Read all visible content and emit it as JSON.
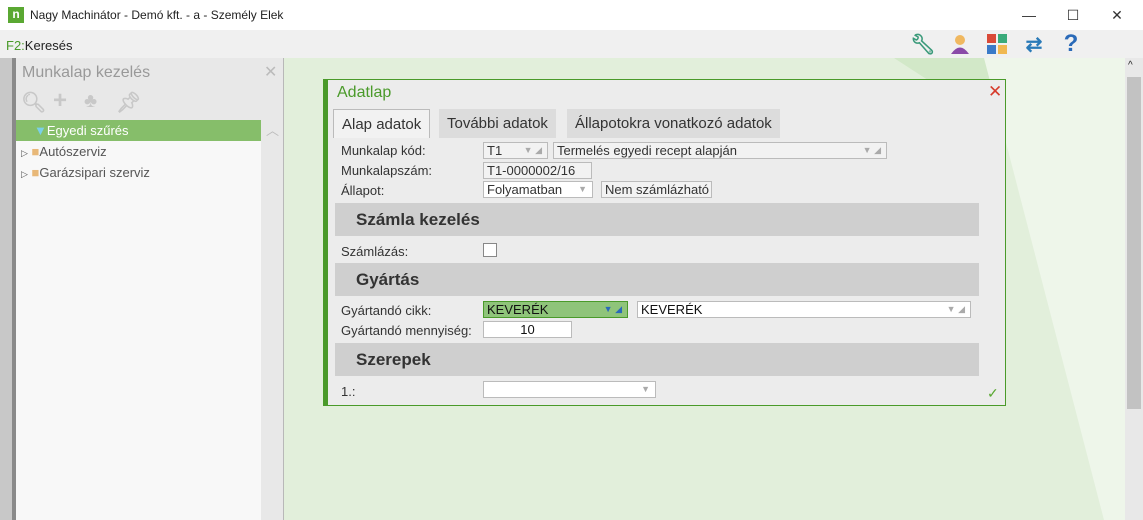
{
  "window": {
    "title": "Nagy Machinátor - Demó kft. - a - Személy Elek",
    "logo": "n",
    "minimize": "—",
    "maximize": "☐",
    "close": "✕"
  },
  "toolbar": {
    "shortcut_key": "F2:",
    "shortcut_label": "Keresés",
    "icons": [
      "wrench-icon",
      "user-icon",
      "tiles-icon",
      "transfer-icon",
      "help-icon"
    ]
  },
  "left_panel": {
    "title": "Munkalap kezelés",
    "tree": [
      {
        "label": "Egyedi szűrés",
        "selected": true
      },
      {
        "label": "Autószerviz"
      },
      {
        "label": "Garázsipari szerviz"
      }
    ]
  },
  "dialog": {
    "title": "Adatlap",
    "tabs": [
      "Alap adatok",
      "További adatok",
      "Állapotokra vonatkozó adatok"
    ],
    "fields": {
      "munkalap_kod_label": "Munkalap kód:",
      "munkalap_kod": "T1",
      "munkalap_kod_desc": "Termelés egyedi recept alapján",
      "munkalapszam_label": "Munkalapszám:",
      "munkalapszam": "T1-0000002/16",
      "allapot_label": "Állapot:",
      "allapot": "Folyamatban",
      "szamlazas_status": "Nem számlázható"
    },
    "sections": {
      "szamla": "Számla kezelés",
      "gyartas": "Gyártás",
      "szerepek": "Szerepek"
    },
    "szamlazas_label": "Számlázás:",
    "szamlazas_checked": false,
    "gyartando_cikk_label": "Gyártandó cikk:",
    "gyartando_cikk": "KEVERÉK",
    "gyartando_cikk_desc": "KEVERÉK",
    "mennyiseg_label": "Gyártandó mennyiség:",
    "mennyiseg": "10",
    "szerep1_label": "1.:",
    "szerep1": ""
  },
  "colors": {
    "accent": "#4a9a2a",
    "selected": "#86be6a"
  }
}
